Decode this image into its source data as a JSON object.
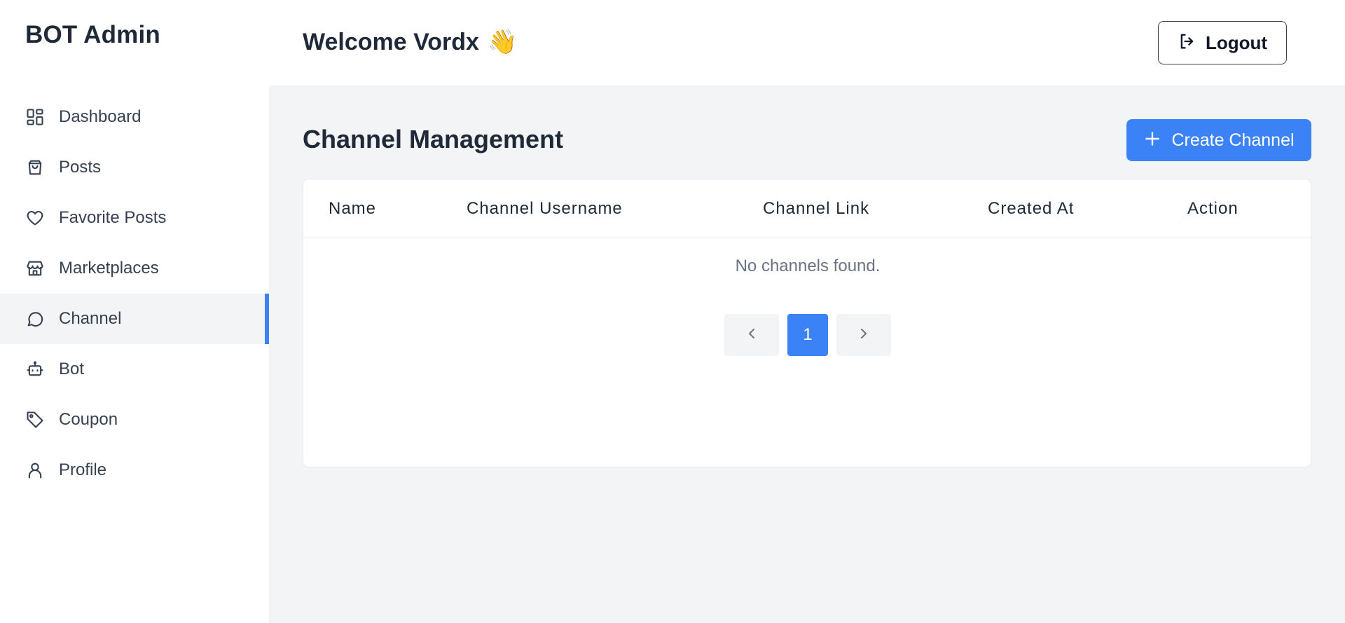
{
  "sidebar": {
    "brand": "BOT Admin",
    "items": [
      {
        "label": "Dashboard",
        "icon": "dashboard-icon"
      },
      {
        "label": "Posts",
        "icon": "shopping-bag-icon"
      },
      {
        "label": "Favorite Posts",
        "icon": "heart-icon"
      },
      {
        "label": "Marketplaces",
        "icon": "store-icon"
      },
      {
        "label": "Channel",
        "icon": "chat-bubble-icon",
        "active": true
      },
      {
        "label": "Bot",
        "icon": "bot-icon"
      },
      {
        "label": "Coupon",
        "icon": "tag-icon"
      },
      {
        "label": "Profile",
        "icon": "user-icon"
      }
    ]
  },
  "header": {
    "welcome": "Welcome Vordx",
    "wave_emoji": "👋",
    "logout_label": "Logout"
  },
  "main": {
    "title": "Channel Management",
    "create_label": "Create Channel",
    "table": {
      "columns": [
        "Name",
        "Channel Username",
        "Channel Link",
        "Created At",
        "Action"
      ],
      "empty_text": "No channels found."
    },
    "pagination": {
      "current_page": "1"
    }
  },
  "colors": {
    "accent": "#3b82f6",
    "sidebar_bg": "#ffffff",
    "content_bg": "#f3f4f6",
    "text": "#1f2937"
  }
}
